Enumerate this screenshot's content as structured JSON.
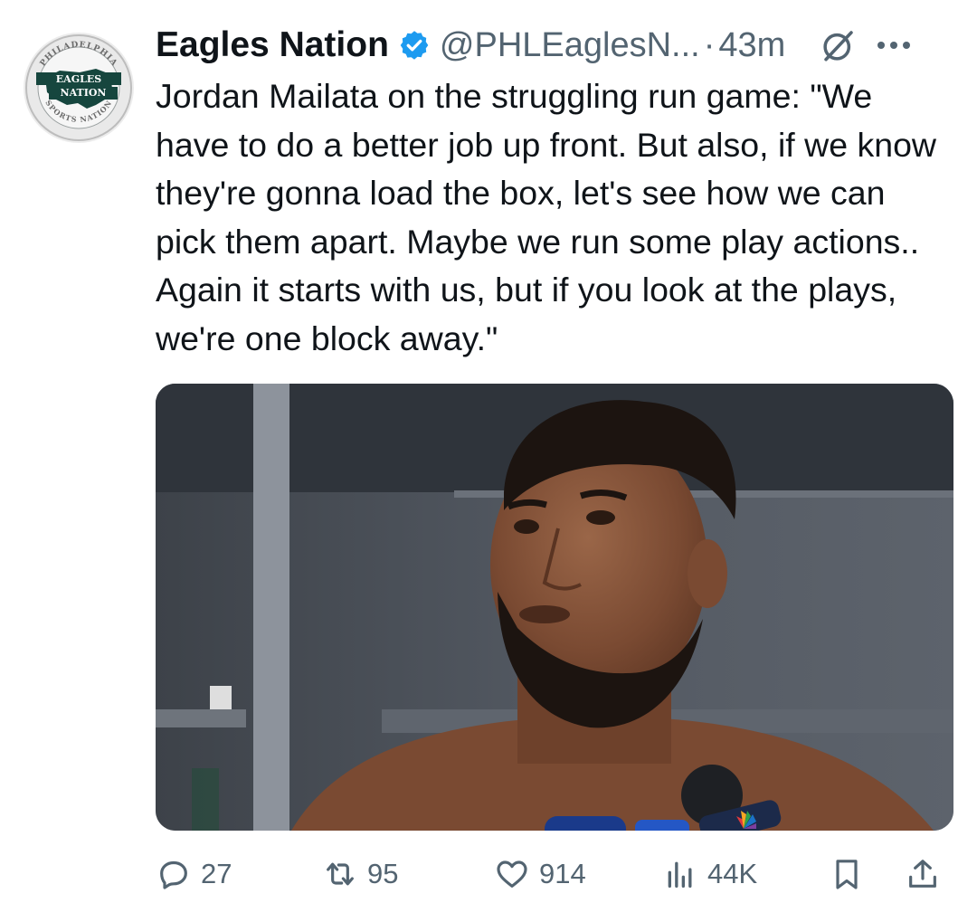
{
  "tweet": {
    "author_name": "Eagles Nation",
    "handle": "@PHLEaglesN...",
    "separator": "·",
    "timestamp": "43m",
    "avatar": {
      "ring_top_text": "PHILADELPHIA",
      "ring_bottom_text": "SPORTS NATION",
      "line1": "EAGLES",
      "line2": "NATION"
    },
    "text": "Jordan Mailata on the struggling run game: \"We have to do a better job up front. But also, if we know they're gonna load the box, let's see how we can pick them apart. Maybe we run some play actions.. Again it starts with us, but if you look at the plays, we're one block away.\"",
    "media_icon": "nbc-peacock-icon",
    "actions": {
      "replies": "27",
      "reposts": "95",
      "likes": "914",
      "views": "44K"
    }
  },
  "colors": {
    "verified": "#1d9bf0",
    "text_primary": "#0f1419",
    "text_secondary": "#536471",
    "background": "#ffffff"
  }
}
